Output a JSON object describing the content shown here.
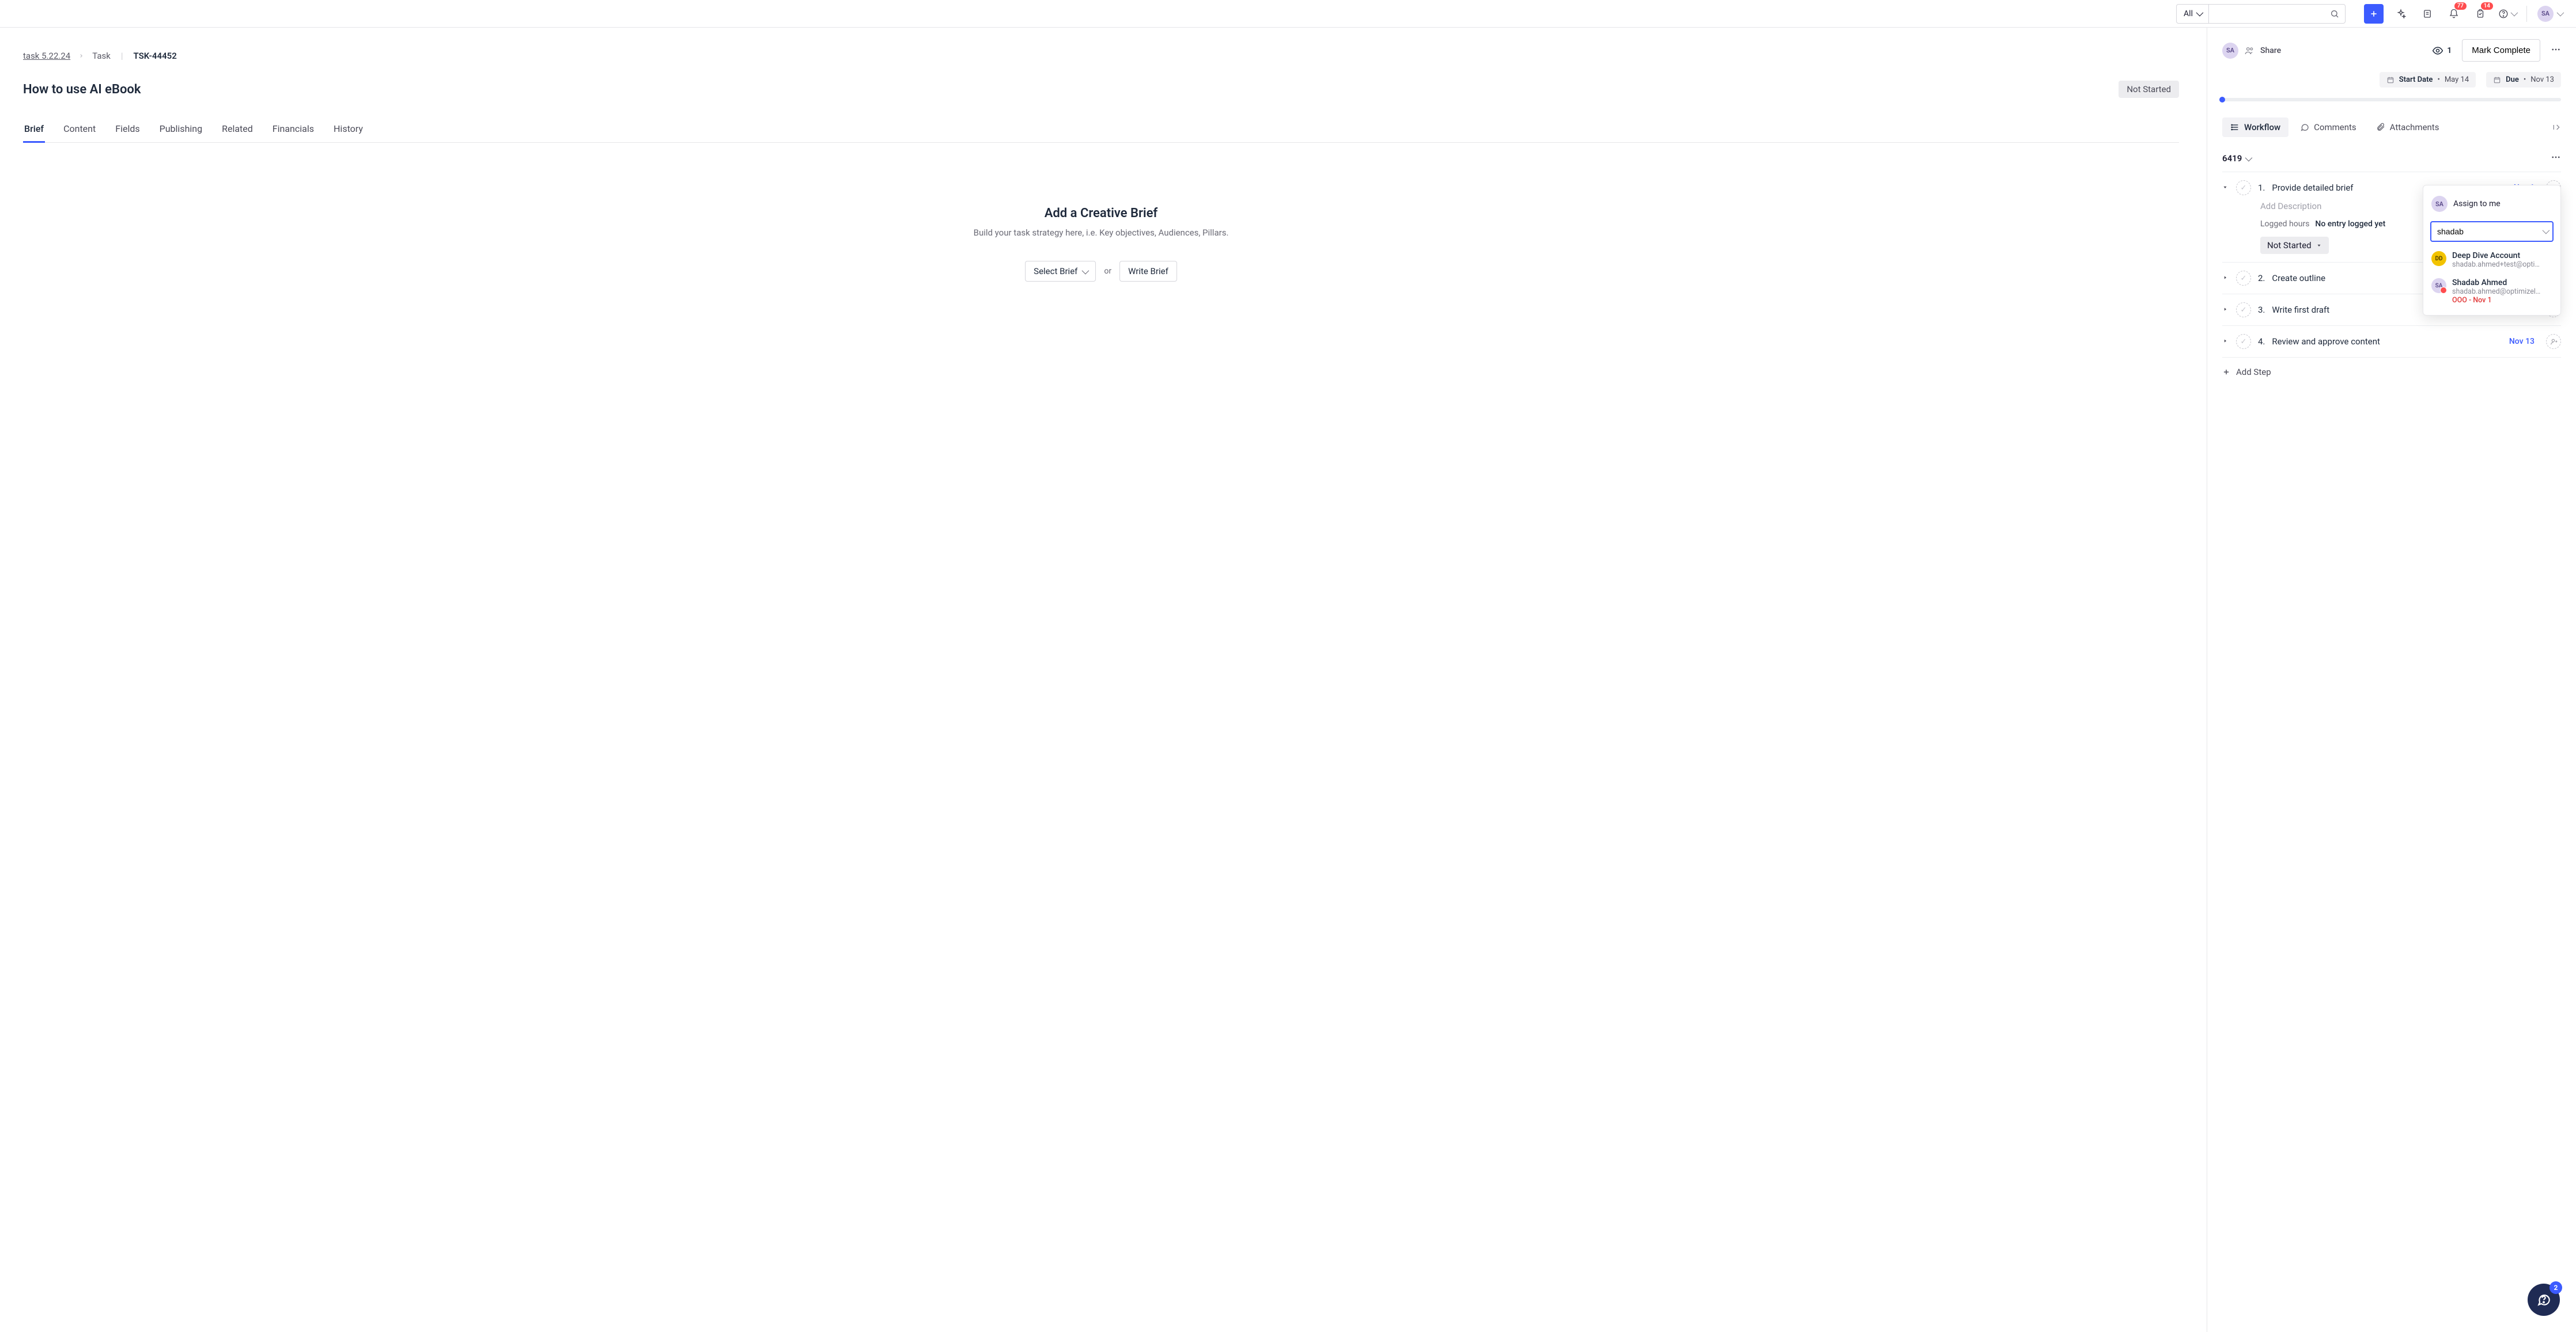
{
  "topbar": {
    "search_scope": "All",
    "notifications_badge": "77",
    "tasks_badge": "14",
    "user_initials": "SA"
  },
  "breadcrumb": {
    "root": "task 5.22.24",
    "type": "Task",
    "id": "TSK-44452"
  },
  "task": {
    "title": "How to use AI eBook",
    "status": "Not Started"
  },
  "tabs": [
    "Brief",
    "Content",
    "Fields",
    "Publishing",
    "Related",
    "Financials",
    "History"
  ],
  "brief_empty": {
    "heading": "Add a Creative Brief",
    "sub": "Build your task strategy here, i.e. Key objectives, Audiences, Pillars.",
    "select_label": "Select Brief",
    "or": "or",
    "write_label": "Write Brief"
  },
  "panel": {
    "share": "Share",
    "views": "1",
    "mark_complete": "Mark Complete",
    "start_label": "Start Date",
    "start_value": "May 14",
    "due_label": "Due",
    "due_value": "Nov 13"
  },
  "subtabs": {
    "workflow": "Workflow",
    "comments": "Comments",
    "attachments": "Attachments"
  },
  "workflow": {
    "number": "6419",
    "steps": [
      {
        "n": "1.",
        "title": "Provide detailed brief",
        "date": "Nov 1",
        "accent": true,
        "expanded": true
      },
      {
        "n": "2.",
        "title": "Create outline",
        "date": "",
        "accent": false,
        "expanded": false
      },
      {
        "n": "3.",
        "title": "Write first draft",
        "date": "",
        "accent": false,
        "expanded": false
      },
      {
        "n": "4.",
        "title": "Review and approve content",
        "date": "Nov 13",
        "accent": true,
        "expanded": false
      }
    ],
    "step1": {
      "add_desc": "Add Description",
      "logged_label": "Logged hours",
      "logged_value": "No entry logged yet",
      "status": "Not Started"
    },
    "add_step": "Add Step"
  },
  "popover": {
    "assign_me": "Assign to me",
    "input_value": "shadab",
    "items": [
      {
        "avatar": "DD",
        "cls": "dd",
        "name": "Deep Dive Account",
        "email": "shadab.ahmed+test@opti…",
        "ooo": ""
      },
      {
        "avatar": "SA",
        "cls": "sa",
        "name": "Shadab Ahmed",
        "email": "shadab.ahmed@optimizel…",
        "ooo": "OOO - Nov 1"
      }
    ]
  },
  "fab_badge": "2"
}
